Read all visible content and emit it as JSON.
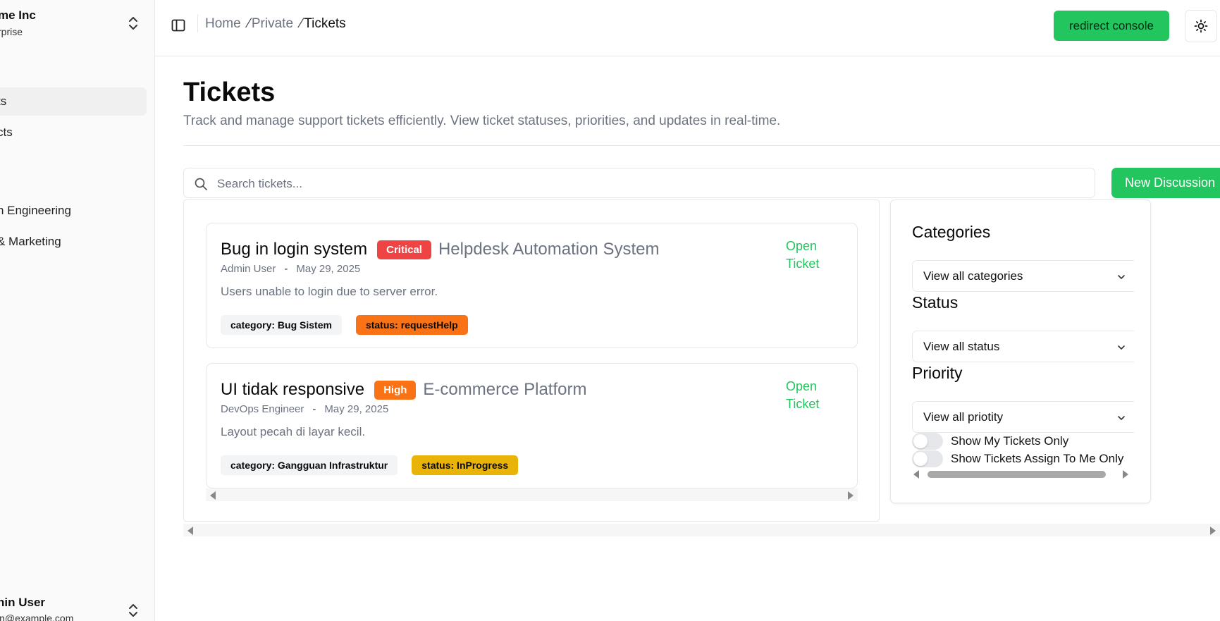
{
  "sidebar": {
    "org_name": "me Inc",
    "org_plan": "rprise",
    "items": [
      {
        "label": "ts"
      },
      {
        "label": "cts"
      },
      {
        "label": "n Engineering"
      },
      {
        "label": "& Marketing"
      }
    ],
    "user_name": "nin User",
    "user_email": "in@example.com"
  },
  "header": {
    "breadcrumb": [
      "Home",
      "Private",
      "Tickets"
    ],
    "breadcrumb_sep": "⁄",
    "redirect_label": "redirect console"
  },
  "page": {
    "title": "Tickets",
    "subtitle": "Track and manage support tickets efficiently. View ticket statuses, priorities, and updates in real-time."
  },
  "search": {
    "placeholder": "Search tickets...",
    "value": ""
  },
  "new_discussion_label": "New Discussion",
  "tickets": [
    {
      "title": "Bug in login system",
      "priority": "Critical",
      "priority_color": "#ef4444",
      "project": "Helpdesk Automation System",
      "author": "Admin User",
      "dash": "-",
      "date": "May 29, 2025",
      "description": "Users unable to login due to server error.",
      "category": "category: Bug Sistem",
      "status": "status: requestHelp",
      "status_color": "#f97316",
      "open_label": "Open Ticket"
    },
    {
      "title": "UI tidak responsive",
      "priority": "High",
      "priority_color": "#f97316",
      "project": "E-commerce Platform",
      "author": "DevOps Engineer",
      "dash": "-",
      "date": "May 29, 2025",
      "description": "Layout pecah di layar kecil.",
      "category": "category: Gangguan Infrastruktur",
      "status": "status: InProgress",
      "status_color": "#eab308",
      "open_label": "Open Ticket"
    }
  ],
  "filters": {
    "categories_label": "Categories",
    "categories_value": "View all categories",
    "status_label": "Status",
    "status_value": "View all status",
    "priority_label": "Priority",
    "priority_value": "View all priotity",
    "my_tickets_label": "Show My Tickets Only",
    "my_tickets_on": false,
    "assigned_label": "Show Tickets Assign To Me Only",
    "assigned_on": false
  },
  "colors": {
    "accent": "#22c55e"
  }
}
